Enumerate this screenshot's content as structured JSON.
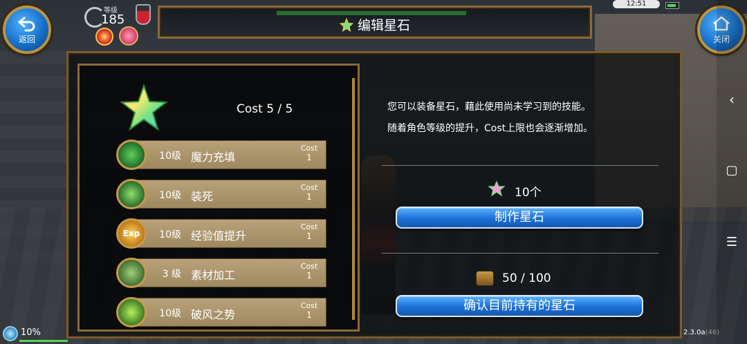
{
  "header": {
    "back_label": "返回",
    "close_label": "关闭",
    "title": "编辑星石",
    "level_label": "等级",
    "level_value": "185",
    "clock": "12:51"
  },
  "left_panel": {
    "cost_text": "Cost 5 / 5",
    "skills": [
      {
        "level": "10级",
        "name": "魔力充填",
        "cost_label": "Cost",
        "cost_value": "1",
        "icon": "mana-figure-icon",
        "color": "#2f8a3c"
      },
      {
        "level": "10级",
        "name": "装死",
        "cost_label": "Cost",
        "cost_value": "1",
        "icon": "play-dead-icon",
        "color": "#2f8a3c"
      },
      {
        "level": "10级",
        "name": "经验值提升",
        "cost_label": "Cost",
        "cost_value": "1",
        "icon": "exp-up-icon",
        "color": "#c98a1e",
        "icon_text": "Exp"
      },
      {
        "level": "3 级",
        "name": "素材加工",
        "cost_label": "Cost",
        "cost_value": "1",
        "icon": "material-process-icon",
        "color": "#4e8a3e"
      },
      {
        "level": "10级",
        "name": "破风之势",
        "cost_label": "Cost",
        "cost_value": "1",
        "icon": "wind-break-icon",
        "color": "#2f8a3c"
      }
    ]
  },
  "right_panel": {
    "description_line1": "您可以装备星石，藉此使用尚未学习到的技能。",
    "description_line2": "随着角色等级的提升，Cost上限也会逐渐增加。",
    "stone_count": "10个",
    "make_button": "制作星石",
    "holding": "50 / 100",
    "confirm_button": "确认目前持有的星石"
  },
  "footer": {
    "percent": "10%",
    "version": "2.3.0a",
    "build": "(46)"
  },
  "colors": {
    "accent_blue": "#1c6fd6",
    "frame_gold": "#8c6a35",
    "row_tan": "#b9a27a"
  }
}
